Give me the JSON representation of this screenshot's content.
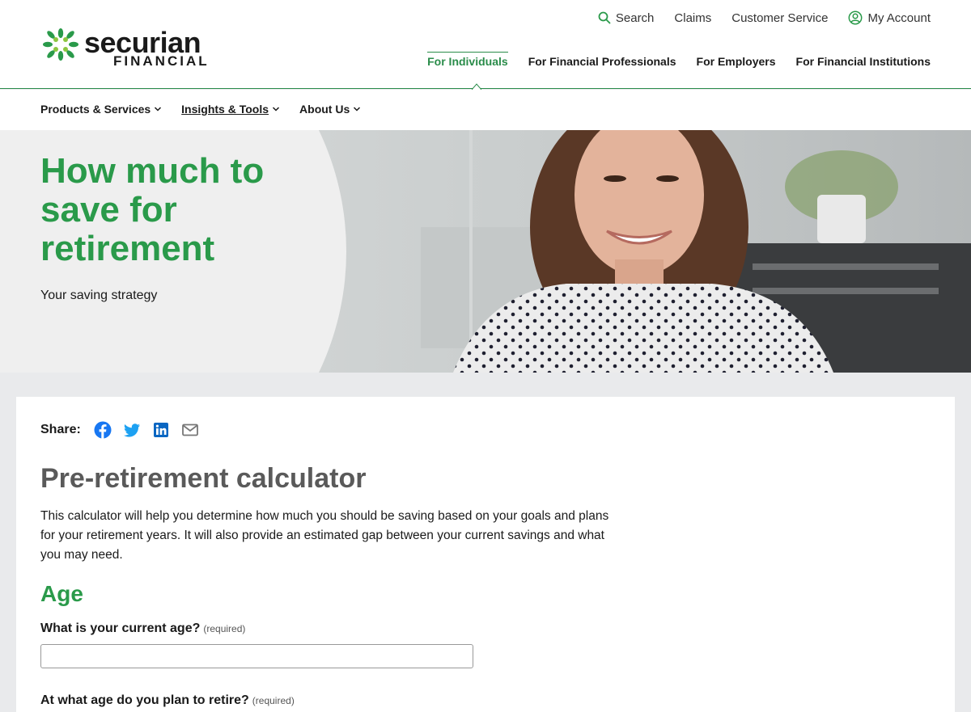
{
  "brand": {
    "name": "securian",
    "sub": "FINANCIAL",
    "color": "#2a9a4a"
  },
  "utility_nav": {
    "search": "Search",
    "claims": "Claims",
    "customer_service": "Customer Service",
    "my_account": "My Account"
  },
  "audience_nav": [
    {
      "label": "For Individuals",
      "active": true
    },
    {
      "label": "For Financial Professionals",
      "active": false
    },
    {
      "label": "For Employers",
      "active": false
    },
    {
      "label": "For Financial Institutions",
      "active": false
    }
  ],
  "sub_nav": [
    {
      "label": "Products & Services"
    },
    {
      "label": "Insights & Tools"
    },
    {
      "label": "About Us"
    }
  ],
  "hero": {
    "title": "How much to save for retirement",
    "subtitle": "Your saving strategy"
  },
  "share": {
    "label": "Share:",
    "icons": [
      "facebook-icon",
      "twitter-icon",
      "linkedin-icon",
      "email-icon"
    ]
  },
  "calculator": {
    "title": "Pre-retirement calculator",
    "description": "This calculator will help you determine how much you should be saving based on your goals and plans for your retirement years. It will also provide an estimated gap between your current savings and what you may need.",
    "section": "Age",
    "q1": {
      "label": "What is your current age?",
      "required": "(required)",
      "value": ""
    },
    "q2": {
      "label": "At what age do you plan to retire?",
      "required": "(required)"
    }
  }
}
